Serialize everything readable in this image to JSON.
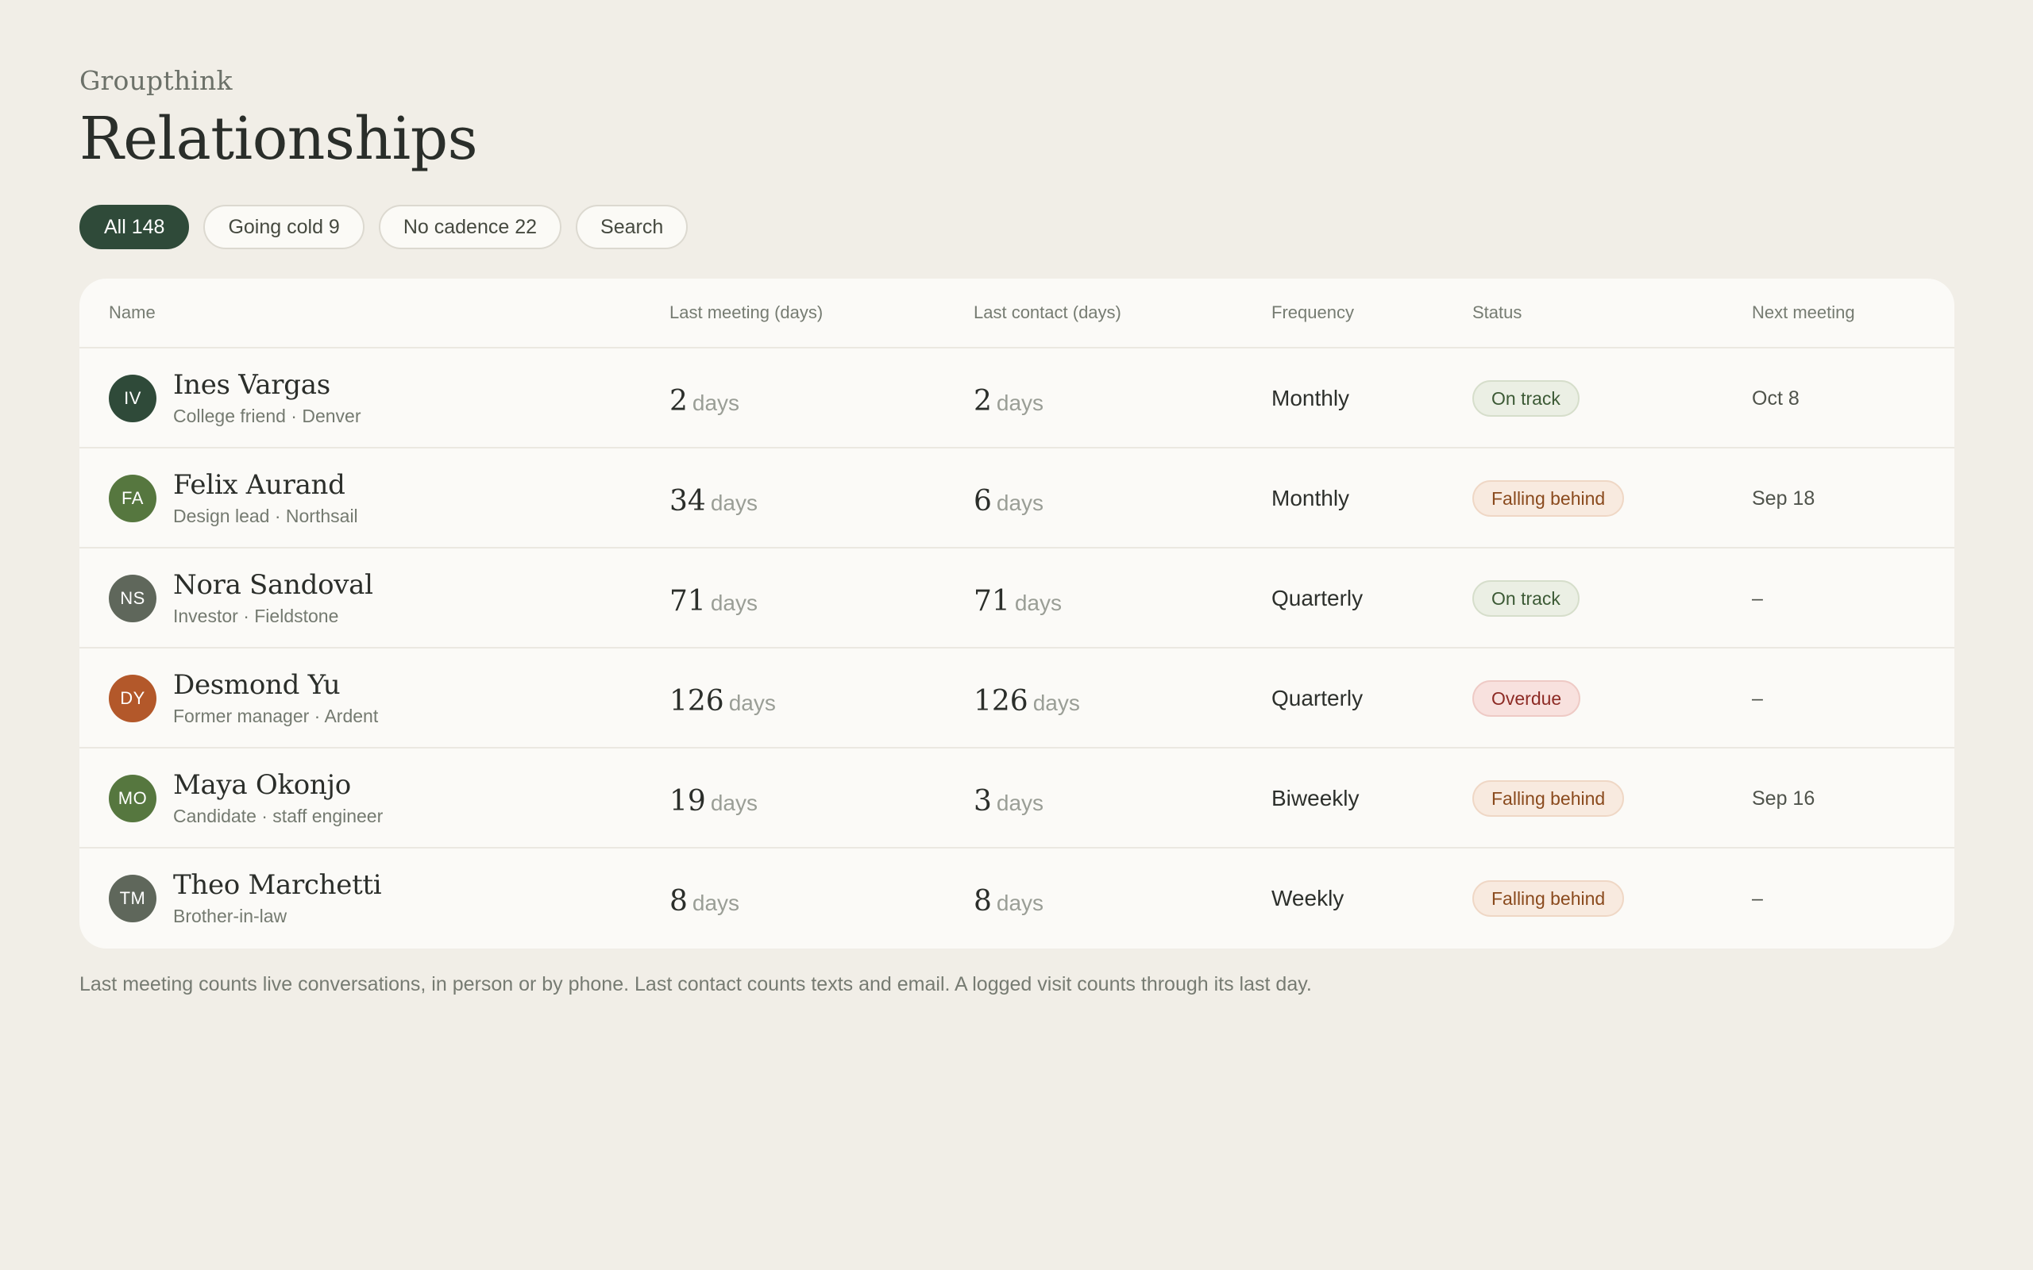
{
  "app": {
    "name": "Groupthink"
  },
  "page": {
    "title": "Relationships"
  },
  "filters": [
    {
      "label": "All 148",
      "active": true
    },
    {
      "label": "Going cold 9",
      "active": false
    },
    {
      "label": "No cadence 22",
      "active": false
    },
    {
      "label": "Search",
      "active": false
    }
  ],
  "table": {
    "headers": {
      "name": "Name",
      "last_meeting": "Last meeting (days)",
      "last_contact": "Last contact (days)",
      "frequency": "Frequency",
      "status": "Status",
      "next_meeting": "Next meeting"
    },
    "day_unit": "days",
    "rows": [
      {
        "initials": "IV",
        "avatar_color": "#2f4a39",
        "name": "Ines Vargas",
        "subtitle": "College friend · Denver",
        "last_meeting": "2",
        "last_contact": "2",
        "frequency": "Monthly",
        "status": "On track",
        "status_kind": "ok",
        "next_meeting": "Oct 8"
      },
      {
        "initials": "FA",
        "avatar_color": "#56773f",
        "name": "Felix Aurand",
        "subtitle": "Design lead · Northsail",
        "last_meeting": "34",
        "last_contact": "6",
        "frequency": "Monthly",
        "status": "Falling behind",
        "status_kind": "behind",
        "next_meeting": "Sep 18"
      },
      {
        "initials": "NS",
        "avatar_color": "#5f675b",
        "name": "Nora Sandoval",
        "subtitle": "Investor · Fieldstone",
        "last_meeting": "71",
        "last_contact": "71",
        "frequency": "Quarterly",
        "status": "On track",
        "status_kind": "ok",
        "next_meeting": "–"
      },
      {
        "initials": "DY",
        "avatar_color": "#b3582a",
        "name": "Desmond Yu",
        "subtitle": "Former manager · Ardent",
        "last_meeting": "126",
        "last_contact": "126",
        "frequency": "Quarterly",
        "status": "Overdue",
        "status_kind": "overdue",
        "next_meeting": "–"
      },
      {
        "initials": "MO",
        "avatar_color": "#56773f",
        "name": "Maya Okonjo",
        "subtitle": "Candidate · staff engineer",
        "last_meeting": "19",
        "last_contact": "3",
        "frequency": "Biweekly",
        "status": "Falling behind",
        "status_kind": "behind",
        "next_meeting": "Sep 16"
      },
      {
        "initials": "TM",
        "avatar_color": "#5f675b",
        "name": "Theo Marchetti",
        "subtitle": "Brother-in-law",
        "last_meeting": "8",
        "last_contact": "8",
        "frequency": "Weekly",
        "status": "Falling behind",
        "status_kind": "behind",
        "next_meeting": "–"
      }
    ]
  },
  "footnote": "Last meeting counts live conversations, in person or by phone. Last contact counts texts and email. A logged visit counts through its last day."
}
